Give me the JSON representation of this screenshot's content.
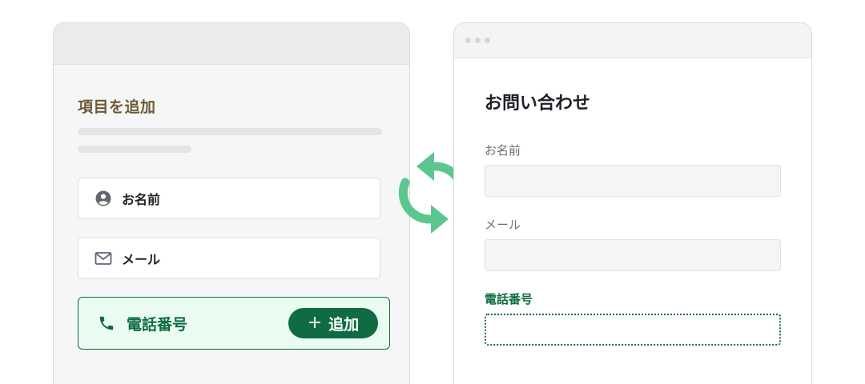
{
  "builder": {
    "title": "項目を追加",
    "fields": [
      {
        "label": "お名前",
        "icon": "user-circle-icon"
      },
      {
        "label": "メール",
        "icon": "mail-icon"
      }
    ],
    "active_field": {
      "label": "電話番号",
      "icon": "phone-icon",
      "add_button_label": "追加",
      "add_button_icon": "plus-icon"
    }
  },
  "sync": {
    "icon": "sync-arrows-icon"
  },
  "preview": {
    "title": "お問い合わせ",
    "fields": [
      {
        "label": "お名前"
      },
      {
        "label": "メール"
      }
    ],
    "new_field": {
      "label": "電話番号"
    }
  },
  "colors": {
    "accent_green": "#0f6b42",
    "sync_green": "#5cc68f",
    "heading_brown": "#6e5a34",
    "active_bg": "#eafbf1"
  }
}
